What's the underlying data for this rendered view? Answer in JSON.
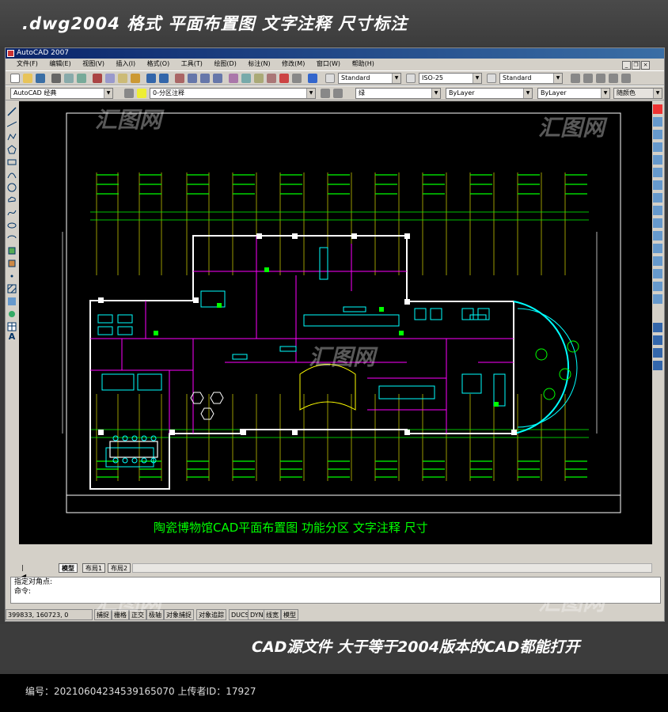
{
  "banner_top": ".dwg2004 格式  平面布置图 文字注释 尺寸标注",
  "window_title": "AutoCAD 2007",
  "menu": [
    "文件(F)",
    "编辑(E)",
    "视图(V)",
    "插入(I)",
    "格式(O)",
    "工具(T)",
    "绘图(D)",
    "标注(N)",
    "修改(M)",
    "窗口(W)",
    "帮助(H)"
  ],
  "window_buttons": [
    "_",
    "❐",
    "×"
  ],
  "toolbar1": {
    "text_style": "Standard",
    "dim_style": "ISO-25",
    "table_style": "Standard"
  },
  "toolbar2": {
    "workspace": "AutoCAD 经典",
    "layer": "0-分区注释",
    "color": "绿",
    "linetype": "ByLayer",
    "lineweight": "ByLayer",
    "plotstyle": "随颜色"
  },
  "drawing_title": "陶瓷博物馆CAD平面布置图   功能分区   文字注释   尺寸",
  "tabs": [
    "模型",
    "布局1",
    "布局2"
  ],
  "command_lines": [
    "指定对角点:",
    "命令:"
  ],
  "coords": "399833, 160723, 0",
  "status_buttons": [
    "捕捉",
    "栅格",
    "正交",
    "极轴",
    "对象捕捉",
    "对象追踪",
    "DUCS",
    "DYN",
    "线宽",
    "模型"
  ],
  "banner_bottom": "CAD源文件  大于等于2004版本的CAD都能打开",
  "footer": "编号：20210604234539165070 上传者ID：17927",
  "watermark": "汇图网",
  "colors": {
    "cad_bg": "#000000",
    "green": "#00ff00",
    "magenta": "#ff00ff",
    "cyan": "#00ffff",
    "yellow": "#ffff00",
    "white": "#ffffff"
  }
}
